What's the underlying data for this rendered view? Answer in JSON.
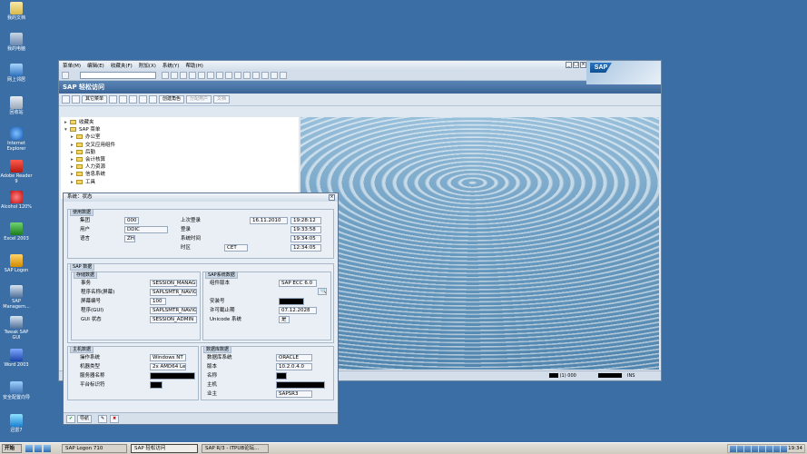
{
  "desktop": {
    "icons": [
      {
        "label": "我的文档",
        "icon": "documents-icon"
      },
      {
        "label": "我的电脑",
        "icon": "computer-icon"
      },
      {
        "label": "网上邻居",
        "icon": "network-icon"
      },
      {
        "label": "回收站",
        "icon": "recycle-bin-icon"
      },
      {
        "label": "Internet Explorer",
        "icon": "internet-explorer-icon"
      },
      {
        "label": "Adobe Reader 9",
        "icon": "adobe-reader-icon"
      },
      {
        "label": "Alcohol 120%",
        "icon": "alcohol-icon"
      },
      {
        "label": "Excel 2003",
        "icon": "excel-icon"
      },
      {
        "label": "SAP Logon",
        "icon": "sap-logon-icon"
      },
      {
        "label": "SAP Managem...",
        "icon": "sap-management-icon"
      },
      {
        "label": "Tweak SAP GUI",
        "icon": "tweak-sap-gui-icon"
      },
      {
        "label": "Word 2003",
        "icon": "word-icon"
      },
      {
        "label": "安全配置向导",
        "icon": "security-wizard-icon"
      },
      {
        "label": "迅雷7",
        "icon": "thunder-icon"
      }
    ]
  },
  "sap_window": {
    "menu": [
      "菜单(M)",
      "编辑(E)",
      "收藏夹(F)",
      "附加(X)",
      "系统(Y)",
      "帮助(H)"
    ],
    "logo": "SAP",
    "title": "SAP 轻松访问",
    "toolbar": {
      "other_menu": "其它菜单",
      "create_role": "创建角色",
      "assign_user": "分配用户",
      "documentation": "文档"
    },
    "tree": [
      {
        "label": "收藏夹",
        "level": 0
      },
      {
        "label": "SAP 菜单",
        "level": 0
      },
      {
        "label": "办公室",
        "level": 1
      },
      {
        "label": "交叉应用组件",
        "level": 1
      },
      {
        "label": "后勤",
        "level": 1
      },
      {
        "label": "会计核算",
        "level": 1
      },
      {
        "label": "人力资源",
        "level": 1
      },
      {
        "label": "信息系统",
        "level": 1
      },
      {
        "label": "工具",
        "level": 1
      }
    ],
    "status": {
      "session": "(1) 000",
      "mode": "INS"
    }
  },
  "dialog": {
    "title": "系统：状态",
    "usage": {
      "header": "使用数据",
      "client_label": "集团",
      "client": "000",
      "user_label": "用户",
      "user": "DDIC",
      "lang_label": "语言",
      "lang": "ZH",
      "last_login_label": "上次登录",
      "last_login_date": "16.11.2010",
      "last_login_time": "19:28:12",
      "logon_label": "登录",
      "logon_time": "19:33:58",
      "systime_label": "系统时间",
      "systime": "19:34:05",
      "tz_label": "时区",
      "tz": "CET",
      "tz_time": "12:34:05"
    },
    "sap_data": {
      "header": "SAP 数据",
      "repo_header": "存储数据",
      "transaction_label": "事务",
      "transaction": "SESSION_MANAGER",
      "program_screen_label": "程序名称(屏幕)",
      "program_screen": "SAPLSMTR_NAVIGATION",
      "screen_no_label": "屏幕编号",
      "screen_no": "100",
      "program_gui_label": "程序(GUI)",
      "program_gui": "SAPLSMTR_NAVIGATION",
      "gui_status_label": "GUI 状态",
      "gui_status": "SESSION_ADMIN",
      "sys_header": "SAP系统数据",
      "component_label": "组件版本",
      "component": "SAP ECC 6.0",
      "install_label": "安装号",
      "license_label": "许可截止期",
      "license": "07.12.2028",
      "unicode_label": "Unicode 系统",
      "unicode": "是"
    },
    "host": {
      "header": "主机数据",
      "os_label": "操作系统",
      "os": "Windows NT",
      "machine_label": "机器类型",
      "machine": "2x AMD64 Level",
      "server_label": "服务器名称",
      "platform_label": "平台标识符"
    },
    "db": {
      "header": "数据库数据",
      "system_label": "数据库系统",
      "system": "ORACLE",
      "release_label": "版本",
      "release": "10.2.0.4.0",
      "name_label": "名称",
      "host_label": "主机",
      "owner_label": "业主",
      "owner": "SAPSR3"
    },
    "footer": {
      "nav": "导航"
    }
  },
  "taskbar": {
    "start": "开始",
    "tasks": [
      "SAP Logon 710",
      "SAP 轻松访问",
      "SAP R/3 - ITPUB论坛..."
    ],
    "clock": "19:34"
  },
  "colors": {
    "desktop": "#3a6ea5",
    "sap_title": "#3a6496",
    "black_mask": "#000000"
  }
}
